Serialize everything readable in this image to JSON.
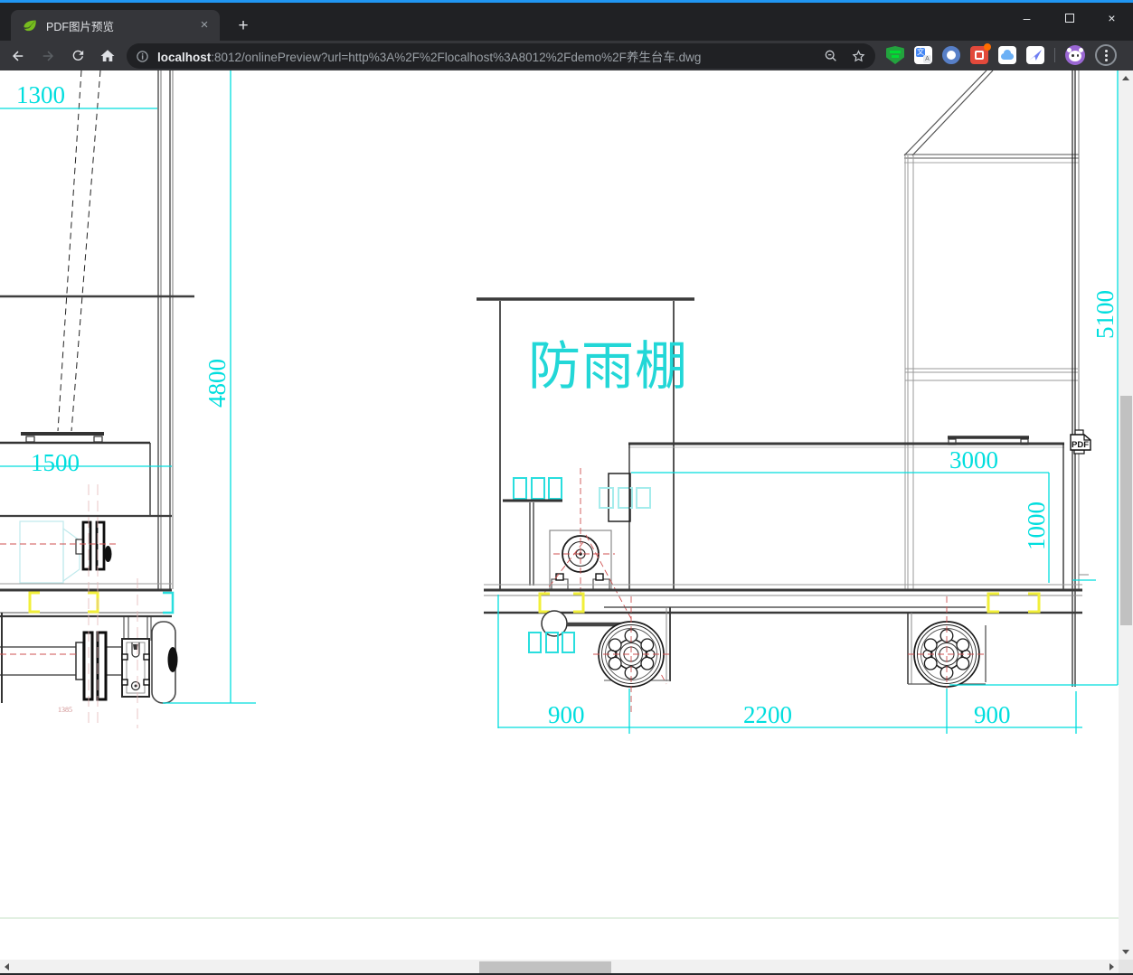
{
  "browser": {
    "window_controls": {
      "minimize": "–",
      "close": "×"
    },
    "tab": {
      "title": "PDF图片预览",
      "close": "×",
      "new_tab": "+"
    },
    "address": {
      "host": "localhost",
      "rest": ":8012/onlinePreview?url=http%3A%2F%2Flocalhost%3A8012%2Fdemo%2F养生台车.dwg"
    },
    "extensions": [
      "tampermonkey-icon",
      "translate-icon",
      "blue-ring-icon",
      "red-badge-icon",
      "cloud-icon",
      "bird-icon"
    ]
  },
  "drawing": {
    "annotation": "防雨棚",
    "pdf_badge": "PDF",
    "dims": {
      "top_left": "1300",
      "body_left": "1500",
      "height_left": "4800",
      "axle_span": "1385",
      "wheel_front_offset": "900",
      "wheel_base": "2200",
      "wheel_rear_offset": "900",
      "box_width": "3000",
      "box_height": "1000",
      "total_height": "5100"
    },
    "colors": {
      "dimension_cyan": "#00dede",
      "annotation_cyan": "#22d7d7",
      "highlight_yellow": "#f1ef39",
      "centerline_red": "#cf5050",
      "line_dark": "#1c1c1c"
    }
  }
}
